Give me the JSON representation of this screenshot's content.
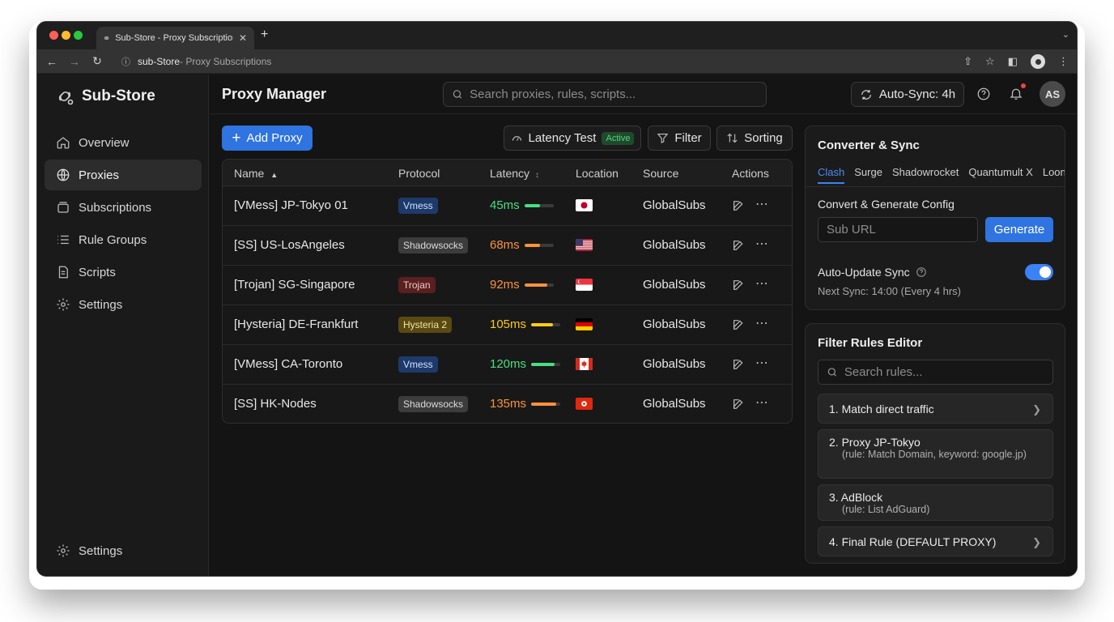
{
  "browser": {
    "tab_title": "Sub-Store - Proxy Subscriptions",
    "url_host": "sub-Store",
    "url_rest": "- Proxy Subscriptions"
  },
  "sidebar": {
    "brand": "Sub-Store",
    "items": [
      {
        "label": "Overview",
        "icon": "home-icon",
        "active": false
      },
      {
        "label": "Proxies",
        "icon": "globe-icon",
        "active": true
      },
      {
        "label": "Subscriptions",
        "icon": "layers-icon",
        "active": false
      },
      {
        "label": "Rule Groups",
        "icon": "list-icon",
        "active": false
      },
      {
        "label": "Scripts",
        "icon": "document-icon",
        "active": false
      },
      {
        "label": "Settings",
        "icon": "gear-icon",
        "active": false
      }
    ],
    "bottom_item": {
      "label": "Settings",
      "icon": "gear-icon"
    }
  },
  "header": {
    "title": "Proxy Manager",
    "search_placeholder": "Search proxies, rules, scripts...",
    "auto_sync": "Auto-Sync: 4h",
    "avatar": "AS"
  },
  "toolbar": {
    "add_proxy": "Add Proxy",
    "latency_test": "Latency Test",
    "latency_badge": "Active",
    "filter": "Filter",
    "sorting": "Sorting"
  },
  "table": {
    "columns": [
      "Name",
      "Protocol",
      "Latency",
      "Location",
      "Source",
      "Actions"
    ],
    "rows": [
      {
        "name": "[VMess] JP-Tokyo 01",
        "protocol": "Vmess",
        "latency": "45ms",
        "latency_level": 0.55,
        "flag": "jp",
        "source": "GlobalSubs"
      },
      {
        "name": "[SS] US-LosAngeles",
        "protocol": "Shadowsocks",
        "latency": "68ms",
        "latency_level": 0.55,
        "flag": "us",
        "source": "GlobalSubs"
      },
      {
        "name": "[Trojan] SG-Singapore",
        "protocol": "Trojan",
        "latency": "92ms",
        "latency_level": 0.8,
        "flag": "sg",
        "source": "GlobalSubs"
      },
      {
        "name": "[Hysteria] DE-Frankfurt",
        "protocol": "Hysteria 2",
        "latency": "105ms",
        "latency_level": 0.75,
        "flag": "de",
        "source": "GlobalSubs"
      },
      {
        "name": "[VMess] CA-Toronto",
        "protocol": "Vmess",
        "latency": "120ms",
        "latency_level": 0.8,
        "flag": "ca",
        "source": "GlobalSubs"
      },
      {
        "name": "[SS] HK-Nodes",
        "protocol": "Shadowsocks",
        "latency": "135ms",
        "latency_level": 0.85,
        "flag": "hk",
        "source": "GlobalSubs"
      }
    ]
  },
  "converter": {
    "title": "Converter & Sync",
    "tabs": [
      "Clash",
      "Surge",
      "Shadowrocket",
      "Quantumult X",
      "Loon"
    ],
    "section_label": "Convert & Generate Config",
    "sub_url_placeholder": "Sub URL",
    "generate": "Generate",
    "auto_update_label": "Auto-Update Sync",
    "auto_update_on": true,
    "next_sync": "Next Sync: 14:00 (Every 4 hrs)"
  },
  "rules": {
    "title": "Filter Rules Editor",
    "search_placeholder": "Search rules...",
    "items": [
      {
        "label": "1. Match direct traffic",
        "note": ""
      },
      {
        "label": "2. Proxy JP-Tokyo",
        "note": "(rule: Match Domain, keyword: google.jp)"
      },
      {
        "label": "3. AdBlock",
        "note": "(rule: List AdGuard)"
      },
      {
        "label": "4. Final Rule (DEFAULT PROXY)",
        "note": ""
      }
    ]
  },
  "colors": {
    "accent": "#2f74e0",
    "latency_green": "#4ade80",
    "latency_orange": "#fb923c",
    "latency_yellow": "#facc15"
  }
}
